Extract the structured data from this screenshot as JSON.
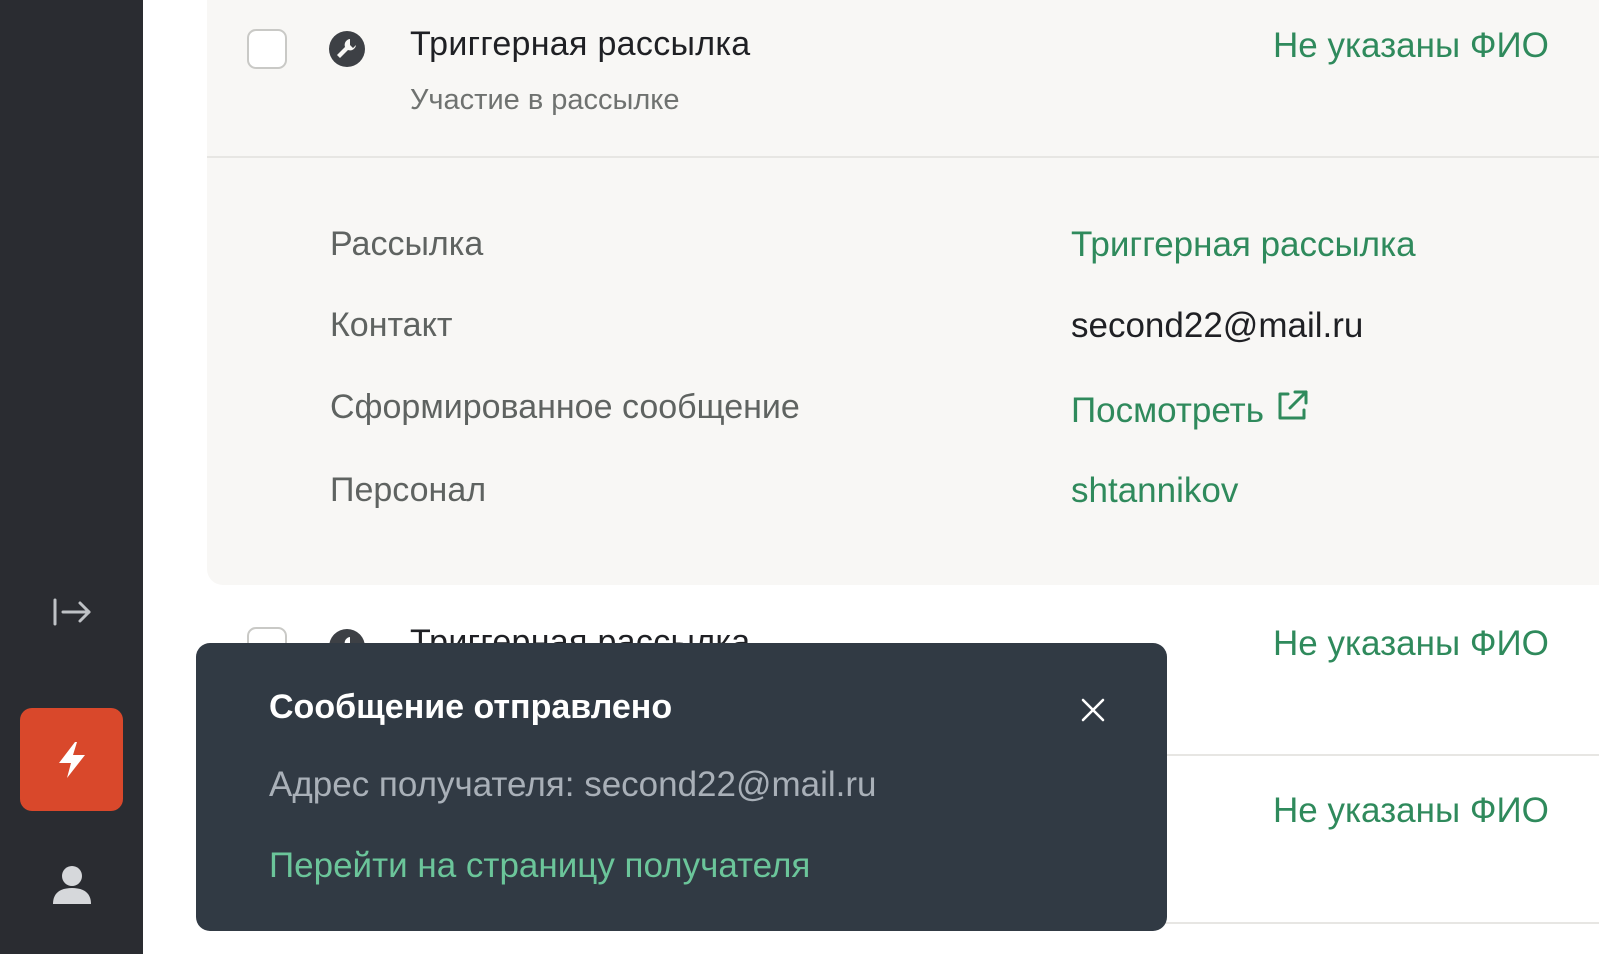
{
  "sidebar": {
    "collapse_icon": "arrow-right-to-bar-icon",
    "active_icon": "lightning-icon",
    "user_icon": "user-icon",
    "accent_color": "#d9482b"
  },
  "expanded_row": {
    "title": "Триггерная рассылка",
    "subtitle": "Участие в рассылке",
    "status": "Не указаны ФИО",
    "icon": "wrench-icon",
    "details": [
      {
        "label": "Рассылка",
        "value": "Триггерная рассылка"
      },
      {
        "label": "Контакт",
        "value": "second22@mail.ru"
      },
      {
        "label": "Сформированное сообщение",
        "value": "Посмотреть"
      },
      {
        "label": "Персонал",
        "value": "shtannikov"
      }
    ]
  },
  "rows": [
    {
      "title": "Триггерная рассылка",
      "status": "Не указаны ФИО"
    },
    {
      "status": "Не указаны ФИО"
    }
  ],
  "toast": {
    "title": "Сообщение отправлено",
    "text": "Адрес получателя: second22@mail.ru",
    "link": "Перейти на страницу получателя",
    "close_icon": "close-icon",
    "background": "#313a44"
  },
  "colors": {
    "green": "#2f8a5c",
    "toast_link": "#6bc59a"
  }
}
